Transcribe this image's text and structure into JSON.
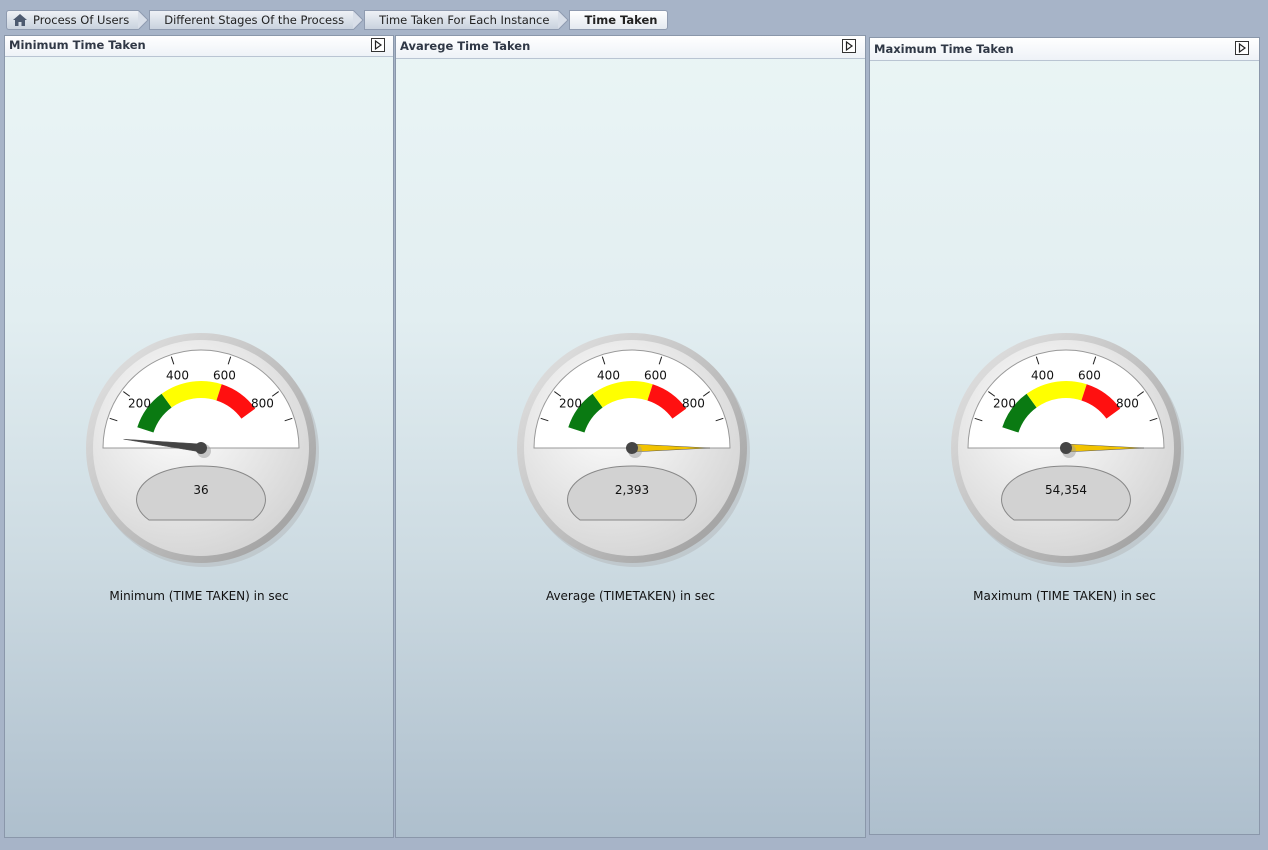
{
  "breadcrumb": {
    "items": [
      "Process Of Users",
      "Different Stages Of the Process",
      "Time Taken For Each Instance",
      "Time Taken"
    ]
  },
  "panels": [
    {
      "title": "Minimum Time Taken",
      "value_label": "36",
      "caption": "Minimum (TIME TAKEN) in sec",
      "needle_color": "#444444",
      "needle_value": 36
    },
    {
      "title": "Avarege Time Taken",
      "value_label": "2,393",
      "caption": "Average (TIMETAKEN) in sec",
      "needle_color": "#f2c300",
      "needle_value": 2393
    },
    {
      "title": "Maximum Time Taken",
      "value_label": "54,354",
      "caption": "Maximum (TIME TAKEN) in sec",
      "needle_color": "#f2c300",
      "needle_value": 54354
    }
  ],
  "gauge": {
    "min": 0,
    "max": 1000,
    "tick_labels": [
      "200",
      "400",
      "600",
      "800"
    ],
    "bands": [
      {
        "from": 100,
        "to": 300,
        "color": "#0a7a12"
      },
      {
        "from": 300,
        "to": 600,
        "color": "#ffff00"
      },
      {
        "from": 600,
        "to": 800,
        "color": "#ff1010"
      }
    ]
  },
  "icons": {
    "home": "home-icon",
    "expand": "expand-arrow-icon"
  }
}
